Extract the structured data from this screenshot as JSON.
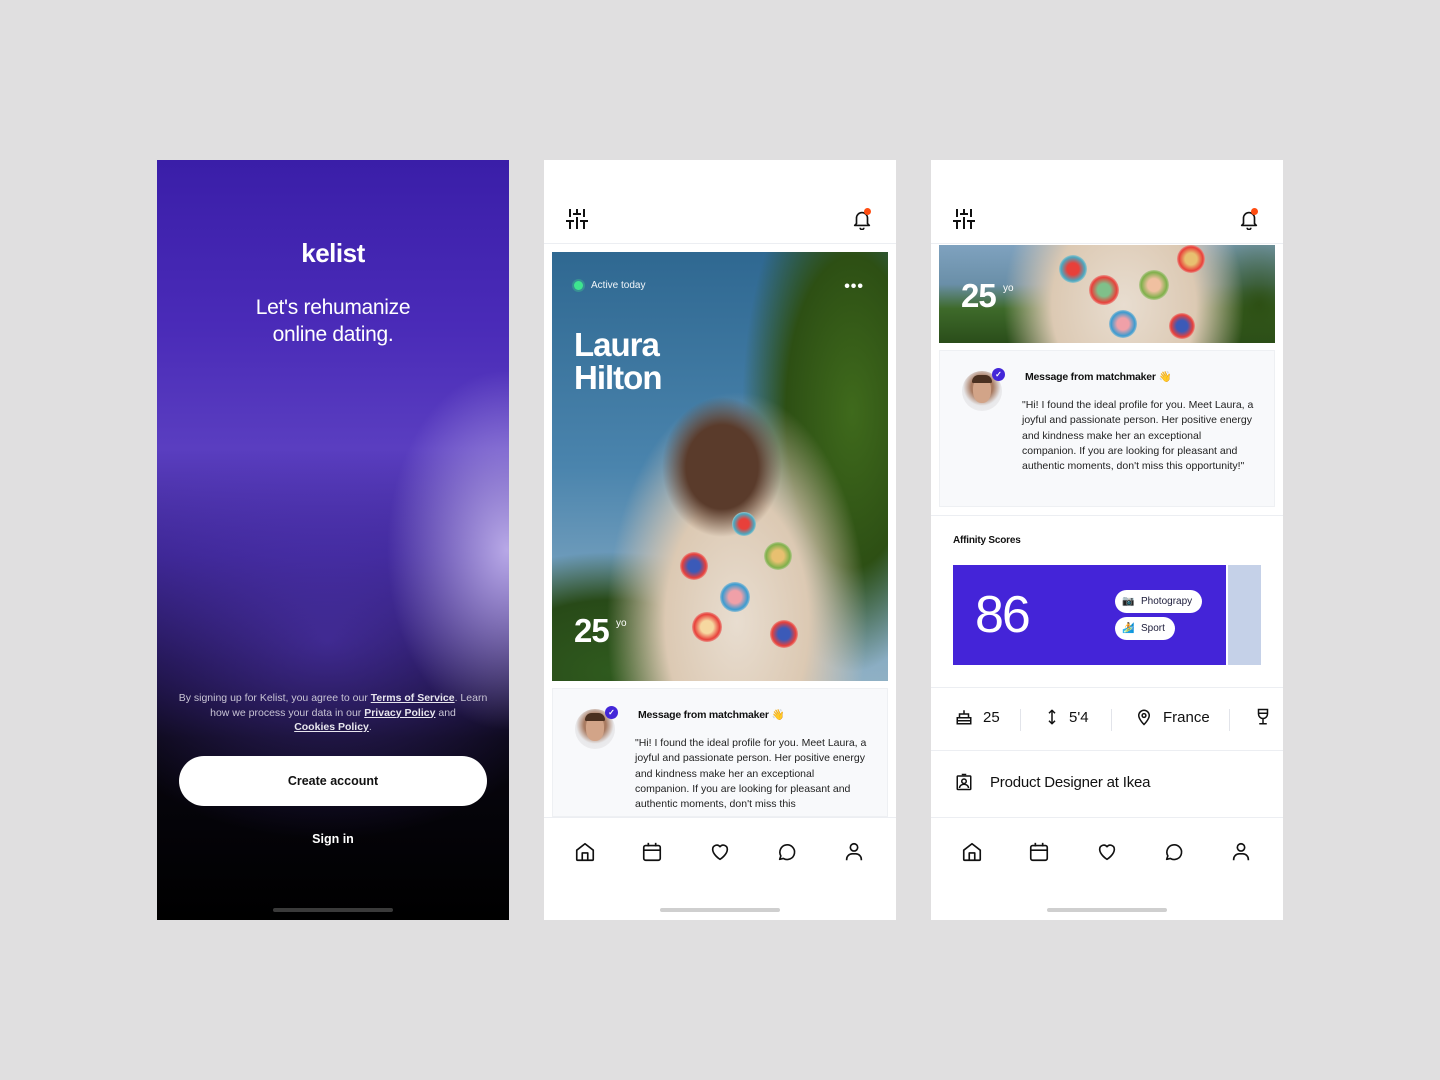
{
  "screens": {
    "welcome": {
      "brand": "kelist",
      "tagline_line1": "Let's rehumanize",
      "tagline_line2": "online dating.",
      "legal": {
        "text1": "By signing up for Kelist, you agree to our ",
        "terms_link": "Terms of Service",
        "text2": ". Learn how we process your data in our ",
        "privacy_link": "Privacy Policy",
        "text3": " and ",
        "cookies_link": "Cookies Policy",
        "text4": "."
      },
      "create_account_label": "Create account",
      "sign_in_label": "Sign in"
    },
    "profile": {
      "header": {
        "filter_icon": "sliders-icon",
        "bell_icon": "bell-icon",
        "has_notification": true
      },
      "status": "Active today",
      "more_label": "•••",
      "first_name": "Laura",
      "last_name": "Hilton",
      "age": "25",
      "age_unit": "yo",
      "message": {
        "title": "Message from matchmaker",
        "emoji": "👋",
        "body_truncated": "\"Hi! I found the ideal profile for you. Meet Laura, a joyful and passionate person. Her positive energy and kindness make her an exceptional companion. If you are looking for pleasant and authentic moments, don't miss this"
      }
    },
    "profile_detail": {
      "age": "25",
      "age_unit": "yo",
      "message": {
        "title": "Message from matchmaker",
        "emoji": "👋",
        "body": "\"Hi! I found the ideal profile for you. Meet Laura, a joyful and passionate person. Her positive energy and kindness make her an exceptional companion. If you are looking for pleasant and authentic moments, don't miss this opportunity!\""
      },
      "affinity": {
        "title": "Affinity Scores",
        "score": "86",
        "chips": [
          {
            "icon": "📷",
            "label": "Photograpy"
          },
          {
            "icon": "🏄",
            "label": "Sport"
          }
        ],
        "accent_color": "#4424d8"
      },
      "stats": [
        {
          "icon": "cake-icon",
          "value": "25"
        },
        {
          "icon": "height-icon",
          "value": "5'4"
        },
        {
          "icon": "location-icon",
          "value": "France"
        },
        {
          "icon": "wine-glass-icon",
          "value": ""
        }
      ],
      "job": "Product Designer at Ikea"
    }
  },
  "bottom_nav": [
    {
      "id": "home",
      "icon": "home-icon"
    },
    {
      "id": "calendar",
      "icon": "calendar-icon"
    },
    {
      "id": "likes",
      "icon": "heart-icon"
    },
    {
      "id": "messages",
      "icon": "chat-icon"
    },
    {
      "id": "profile",
      "icon": "user-icon"
    }
  ],
  "colors": {
    "accent": "#4424d8",
    "notification": "#ff4d12",
    "active": "#3ee58f",
    "background": "#e0dfe0"
  }
}
